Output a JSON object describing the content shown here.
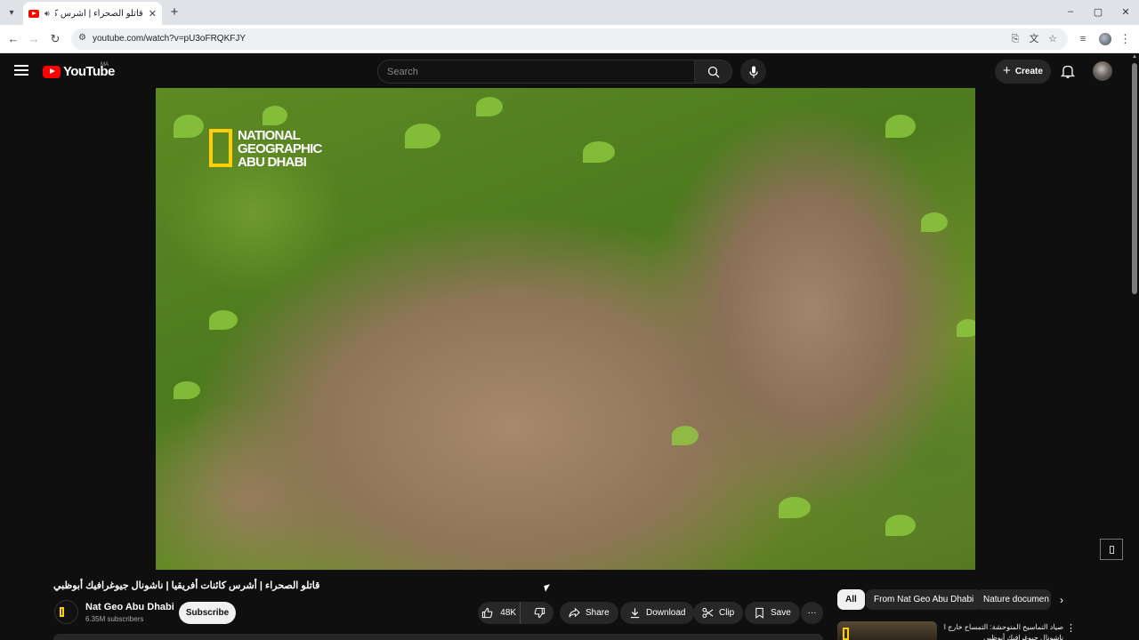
{
  "browser": {
    "tab_title": "قاتلو الصحراء | أشرس كائنات",
    "new_tab_symbol": "+",
    "url": "youtube.com/watch?v=pU3oFRQKFJY",
    "window_controls": {
      "minimize": "–",
      "maximize": "▢",
      "close": "✕"
    }
  },
  "youtube": {
    "logo_text": "YouTube",
    "region": "MA",
    "search_placeholder": "Search",
    "create_label": "Create"
  },
  "video": {
    "overlay_logo": [
      "NATIONAL",
      "GEOGRAPHIC",
      "ABU DHABI"
    ],
    "title": "قاتلو الصحراء | أشرس كائنات أفريقيا | ناشونال جيوغرافيك أبوظبي"
  },
  "channel": {
    "name": "Nat Geo Abu Dhabi",
    "subscribers": "6.35M subscribers",
    "subscribe_label": "Subscribe"
  },
  "actions": {
    "likes": "48K",
    "share": "Share",
    "download": "Download",
    "clip": "Clip",
    "save": "Save",
    "more": "···"
  },
  "chips": [
    "All",
    "From Nat Geo Abu Dhabi",
    "Nature documen"
  ],
  "recommendation": {
    "title_line1": "صياد التماسيح المتوحشة: التمساح خارج الماء",
    "title_line2": "ناشونال جيوغرافيك أبوظبي"
  },
  "colors": {
    "accent_red": "#ff0000",
    "natgeo_yellow": "#ffce00",
    "background": "#0f0f0f"
  }
}
